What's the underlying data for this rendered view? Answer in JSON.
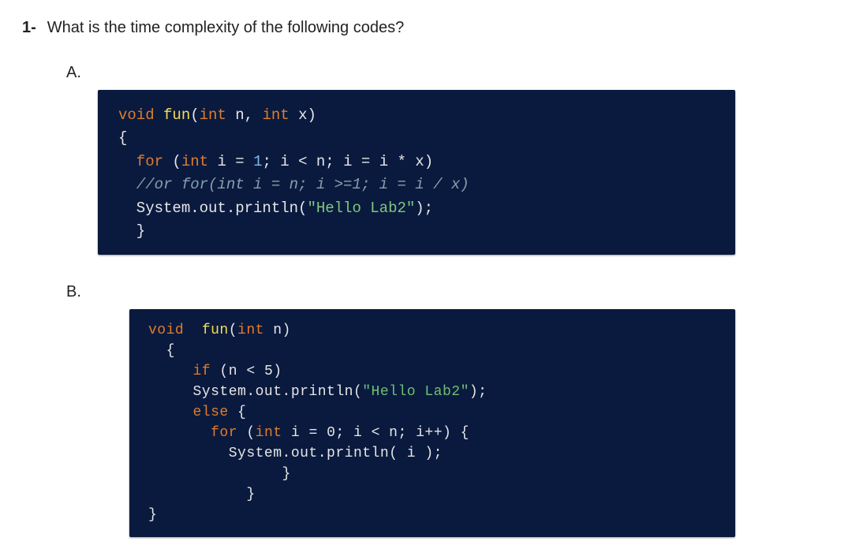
{
  "question_number": "1-",
  "question_text": "What is the time complexity of the following codes?",
  "part_a_label": "A.",
  "part_b_label": "B.",
  "code_a": {
    "l1_kw1": "void",
    "l1_fn": " fun",
    "l1_rest1": "(",
    "l1_kw2": "int",
    "l1_rest2": " n, ",
    "l1_kw3": "int",
    "l1_rest3": " x)",
    "l2": "{",
    "l3_kw": "  for ",
    "l3_p1": "(",
    "l3_kw2": "int",
    "l3_p2": " i = ",
    "l3_n1": "1",
    "l3_p3": "; i < n; i = i * x)",
    "l4_cmt": "  //or for(int i = n; i >=1; i = i / x)",
    "l5_p1": "  System.out.println(",
    "l5_str": "\"Hello Lab2\"",
    "l5_p2": ");",
    "l6": "  }"
  },
  "code_b": {
    "l1_kw1": "void",
    "l1_fn": "  fun",
    "l1_p1": "(",
    "l1_kw2": "int",
    "l1_p2": " n)",
    "l2": "  {",
    "l3_kw": "     if ",
    "l3_rest": "(n < ",
    "l3_n": "5",
    "l3_rest2": ")",
    "l4_p1": "     System.out.println(",
    "l4_str": "\"Hello Lab2\"",
    "l4_p2": ");",
    "l5_kw": "     else ",
    "l5_rest": "{",
    "l6_kw": "       for ",
    "l6_p1": "(",
    "l6_kw2": "int",
    "l6_p2": " i = ",
    "l6_n": "0",
    "l6_p3": "; i < n; i++) {",
    "l7": "         System.out.println( i );",
    "l8": "               }",
    "l9": "           }",
    "l10": "}"
  }
}
